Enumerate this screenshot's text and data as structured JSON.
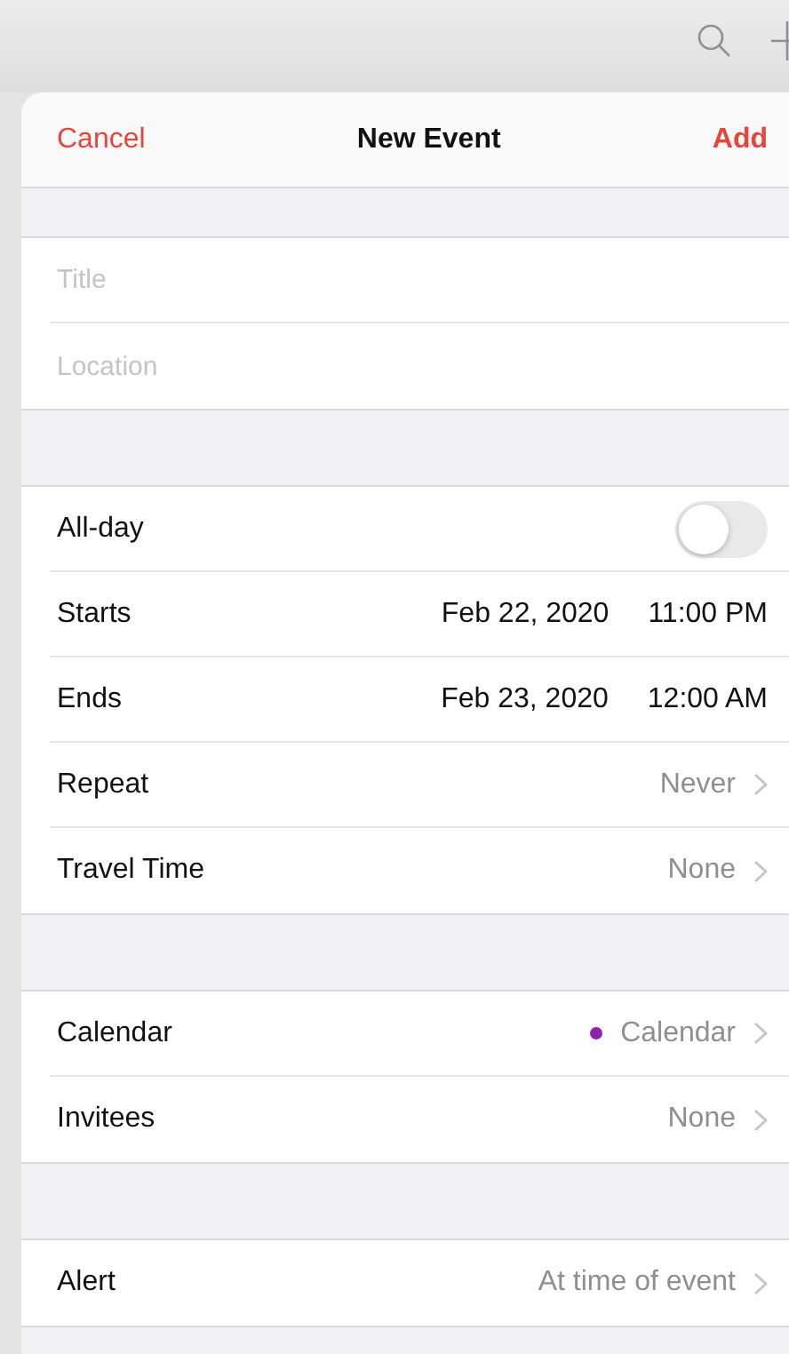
{
  "nav": {
    "cancel": "Cancel",
    "title": "New Event",
    "add": "Add"
  },
  "fields": [
    {
      "placeholder": "Title"
    },
    {
      "placeholder": "Location"
    }
  ],
  "sections": [
    [
      {
        "kind": "toggle",
        "label": "All-day",
        "on": false
      },
      {
        "kind": "datetime",
        "label": "Starts",
        "date": "Feb 22, 2020",
        "time": "11:00 PM"
      },
      {
        "kind": "datetime",
        "label": "Ends",
        "date": "Feb 23, 2020",
        "time": "12:00 AM"
      },
      {
        "kind": "value",
        "label": "Repeat",
        "value": "Never"
      },
      {
        "kind": "value",
        "label": "Travel Time",
        "value": "None"
      }
    ],
    [
      {
        "kind": "calendar",
        "label": "Calendar",
        "value": "Calendar",
        "color": "#8e24aa"
      },
      {
        "kind": "value",
        "label": "Invitees",
        "value": "None"
      }
    ],
    [
      {
        "kind": "value",
        "label": "Alert",
        "value": "At time of event"
      }
    ]
  ]
}
